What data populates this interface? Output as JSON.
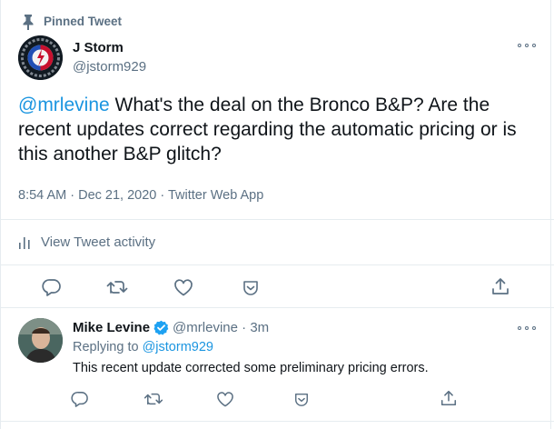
{
  "pinned": {
    "label": "Pinned Tweet",
    "icon": "pin-icon"
  },
  "tweet": {
    "author_name": "J Storm",
    "author_handle": "@jstorm929",
    "mention": "@mrlevine",
    "text": " What's the deal on the Bronco B&P? Are the recent updates correct regarding the automatic pricing or is this another B&P glitch?",
    "time": "8:54 AM",
    "date": "Dec 21, 2020",
    "source": "Twitter Web App",
    "activity_label": "View Tweet activity"
  },
  "actions": [
    {
      "name": "reply-icon"
    },
    {
      "name": "retweet-icon"
    },
    {
      "name": "like-icon"
    },
    {
      "name": "save-icon"
    },
    {
      "name": "share-icon"
    }
  ],
  "reply": {
    "author_name": "Mike Levine",
    "verified_icon": "verified-badge-icon",
    "author_handle": "@mrlevine",
    "time": "3m",
    "replying_prefix": "Replying to ",
    "replying_to": "@jstorm929",
    "text": "This recent update corrected some preliminary pricing errors."
  },
  "colors": {
    "accent": "#1b95e0",
    "secondary_text": "#5b7083",
    "border": "#e6ecf0"
  }
}
